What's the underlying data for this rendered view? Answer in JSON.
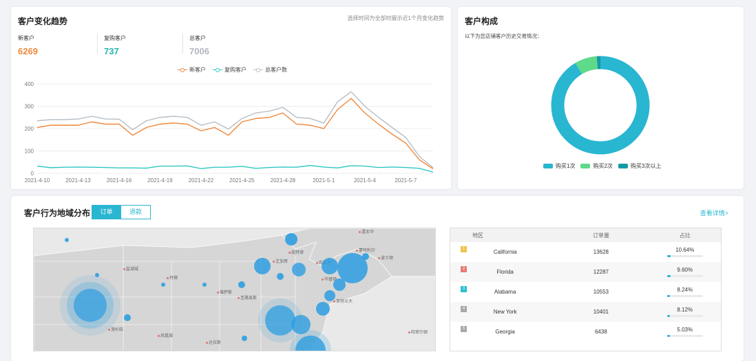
{
  "trend": {
    "title": "客户变化趋势",
    "hint": "选择时间为全部时展示近1个月变化趋势",
    "stats": [
      {
        "label": "新客户",
        "value": "6269",
        "color": "#f0883a"
      },
      {
        "label": "复购客户",
        "value": "737",
        "color": "#29b6b0"
      },
      {
        "label": "总客户",
        "value": "7006",
        "color": "#b0b7bf"
      }
    ]
  },
  "chart_data": {
    "type": "line",
    "x": [
      "2021-4-10",
      "2021-4-11",
      "2021-4-12",
      "2021-4-13",
      "2021-4-14",
      "2021-4-15",
      "2021-4-16",
      "2021-4-17",
      "2021-4-18",
      "2021-4-19",
      "2021-4-20",
      "2021-4-21",
      "2021-4-22",
      "2021-4-23",
      "2021-4-24",
      "2021-4-25",
      "2021-4-26",
      "2021-4-27",
      "2021-4-28",
      "2021-4-29",
      "2021-4-30",
      "2021-5-1",
      "2021-5-2",
      "2021-5-3",
      "2021-5-4",
      "2021-5-5",
      "2021-5-6",
      "2021-5-7",
      "2021-5-8",
      "2021-5-9"
    ],
    "tick_labels": [
      "2021-4-10",
      "2021-4-13",
      "2021-4-16",
      "2021-4-19",
      "2021-4-22",
      "2021-4-25",
      "2021-4-28",
      "2021-5-1",
      "2021-5-4",
      "2021-5-7"
    ],
    "series": [
      {
        "name": "新客户",
        "color": "#f0883a",
        "values": [
          205,
          215,
          215,
          215,
          230,
          220,
          220,
          170,
          205,
          220,
          225,
          220,
          190,
          205,
          170,
          230,
          245,
          250,
          270,
          220,
          215,
          200,
          285,
          335,
          270,
          220,
          175,
          135,
          60,
          20
        ]
      },
      {
        "name": "复购客户",
        "color": "#2ec7c0",
        "values": [
          32,
          25,
          27,
          28,
          27,
          26,
          24,
          24,
          23,
          32,
          32,
          33,
          21,
          27,
          27,
          31,
          22,
          26,
          28,
          27,
          35,
          28,
          24,
          34,
          32,
          26,
          28,
          26,
          22,
          5
        ]
      },
      {
        "name": "总客户数",
        "color": "#b6bec6",
        "values": [
          235,
          240,
          240,
          243,
          255,
          243,
          242,
          195,
          235,
          250,
          255,
          250,
          215,
          230,
          198,
          245,
          270,
          278,
          295,
          250,
          245,
          225,
          320,
          365,
          300,
          250,
          205,
          160,
          75,
          25
        ]
      }
    ],
    "ylim": [
      0,
      400
    ],
    "y_ticks": [
      0,
      100,
      200,
      300,
      400
    ],
    "grid": true,
    "legend": "top-center"
  },
  "composition": {
    "title": "客户构成",
    "subtitle": "以下为您店铺客户历史交易情况：",
    "chart_data": {
      "type": "pie",
      "labels": [
        "购买1次",
        "购买2次",
        "购买3次以上"
      ],
      "values": [
        91.5,
        7.3,
        1.2
      ],
      "colors": [
        "#29b6d1",
        "#5fd98a",
        "#169aa5"
      ]
    }
  },
  "region": {
    "title": "客户行为地域分布",
    "tabs": [
      "订单",
      "退款"
    ],
    "detail_link": "查看详情>",
    "map_labels": [
      "渥太华",
      "蒙特利尔",
      "魁北克",
      "波士顿",
      "纽约",
      "费城",
      "芝加哥",
      "底特律",
      "多伦多",
      "匹兹堡",
      "华盛顿",
      "圣路易斯",
      "堪萨斯",
      "丹佛",
      "盐湖城",
      "旧金山",
      "洛杉矶",
      "达拉斯",
      "休斯顿",
      "新奥尔良",
      "亚特兰大",
      "哈密尔顿",
      "圣安东尼奥",
      "凤凰城",
      "圣地亚哥",
      "维多利亚"
    ],
    "table": {
      "headers": [
        "地区",
        "订单量",
        "占比"
      ],
      "rows": [
        {
          "rank": "1",
          "rank_color": "#f0c24b",
          "region": "California",
          "orders": "13628",
          "pct": "10.64%",
          "frac": 0.1064
        },
        {
          "rank": "2",
          "rank_color": "#e77b73",
          "region": "Florida",
          "orders": "12287",
          "pct": "9.60%",
          "frac": 0.096
        },
        {
          "rank": "3",
          "rank_color": "#29c0d1",
          "region": "Alabama",
          "orders": "10553",
          "pct": "8.24%",
          "frac": 0.0824
        },
        {
          "rank": "4",
          "rank_color": "#a8a8a8",
          "region": "New York",
          "orders": "10401",
          "pct": "8.12%",
          "frac": 0.0812
        },
        {
          "rank": "5",
          "rank_color": "#a8a8a8",
          "region": "Georgia",
          "orders": "6438",
          "pct": "5.03%",
          "frac": 0.0503
        }
      ]
    }
  }
}
